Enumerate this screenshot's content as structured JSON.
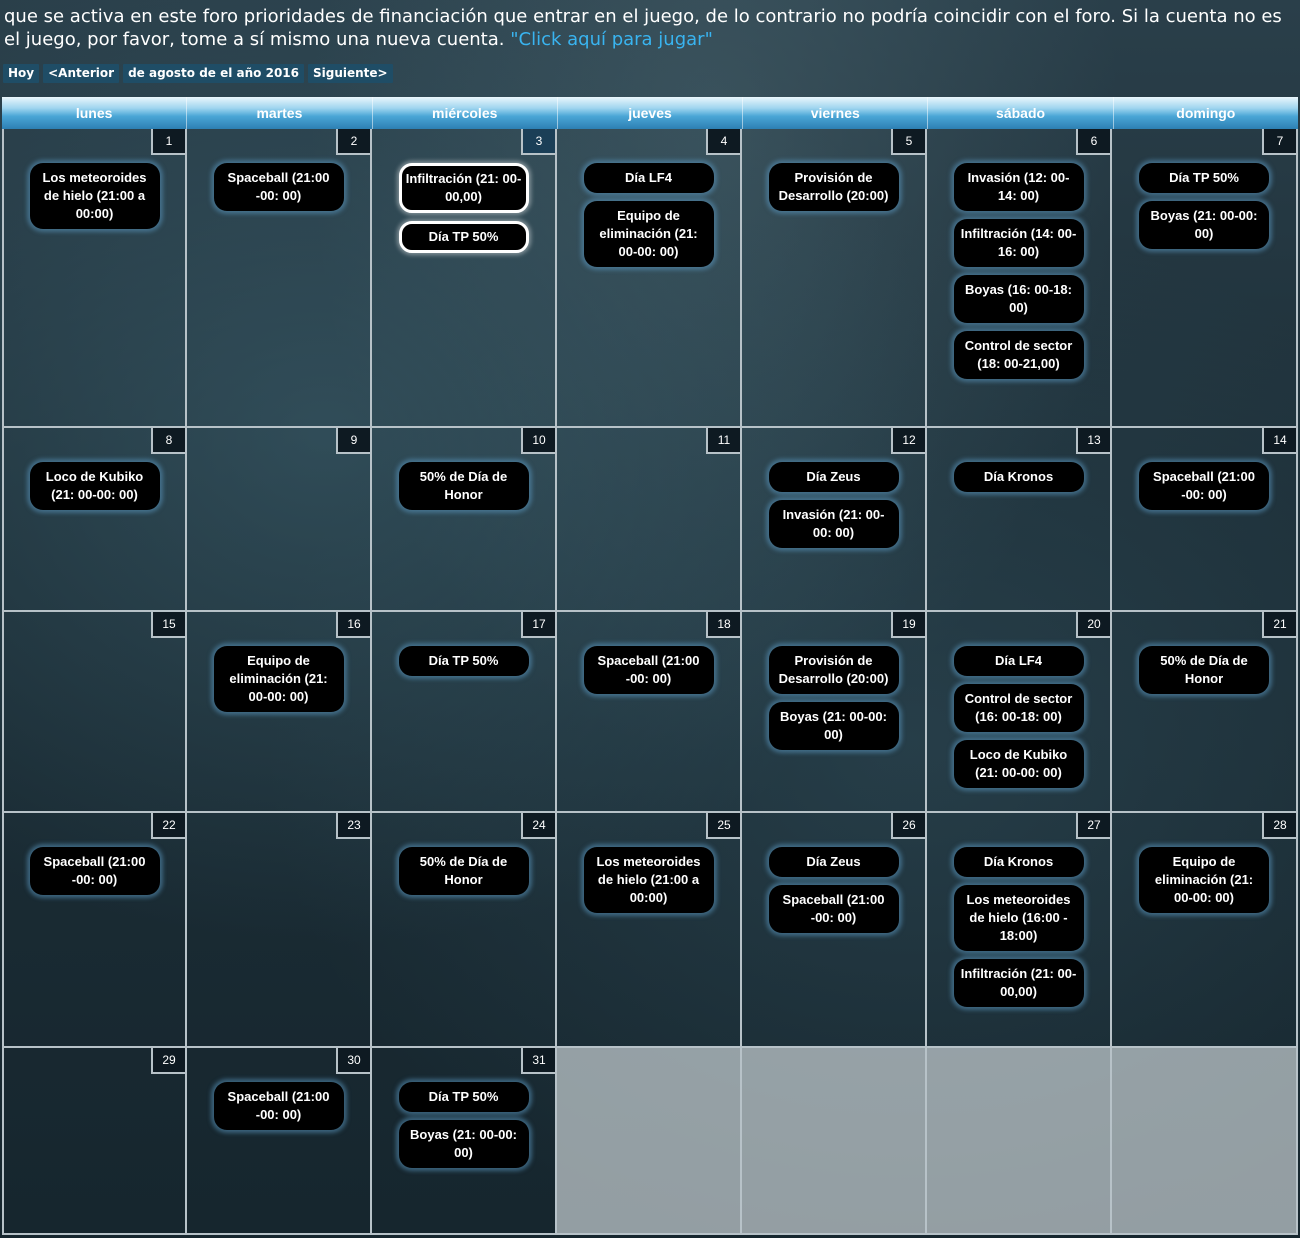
{
  "intro": {
    "text": "que se activa en este foro prioridades de financiación que entrar en el juego, de lo contrario no podría coincidir con el foro. Si la cuenta no es el juego, por favor, tome a sí mismo una nueva cuenta. ",
    "link": "\"Click aquí para jugar\""
  },
  "nav": {
    "today": "Hoy",
    "prev": "<Anterior",
    "month": "de agosto de el año 2016",
    "next": "Siguiente>"
  },
  "weekdays": [
    "lunes",
    "martes",
    "miércoles",
    "jueves",
    "viernes",
    "sábado",
    "domingo"
  ],
  "today_day": 3,
  "weeks": [
    [
      {
        "day": "1",
        "events": [
          "Los meteoroides de hielo (21:00 a 00:00)"
        ]
      },
      {
        "day": "2",
        "events": [
          "Spaceball (21:00 -00: 00)"
        ]
      },
      {
        "day": "3",
        "events": [
          "Infiltración (21: 00-00,00)",
          "Día TP 50%"
        ]
      },
      {
        "day": "4",
        "events": [
          "Día LF4",
          "Equipo de eliminación (21: 00-00: 00)"
        ]
      },
      {
        "day": "5",
        "events": [
          "Provisión de Desarrollo (20:00)"
        ]
      },
      {
        "day": "6",
        "events": [
          "Invasión (12: 00-14: 00)",
          "Infiltración (14: 00-16: 00)",
          "Boyas (16: 00-18: 00)",
          "Control de sector (18: 00-21,00)"
        ]
      },
      {
        "day": "7",
        "events": [
          "Día TP 50%",
          "Boyas (21: 00-00: 00)"
        ]
      }
    ],
    [
      {
        "day": "8",
        "events": [
          "Loco de Kubiko (21: 00-00: 00)"
        ]
      },
      {
        "day": "9",
        "events": []
      },
      {
        "day": "10",
        "events": [
          "50% de Día de Honor"
        ]
      },
      {
        "day": "11",
        "events": []
      },
      {
        "day": "12",
        "events": [
          "Día Zeus",
          "Invasión (21: 00-00: 00)"
        ]
      },
      {
        "day": "13",
        "events": [
          "Día Kronos"
        ]
      },
      {
        "day": "14",
        "events": [
          "Spaceball (21:00 -00: 00)"
        ]
      }
    ],
    [
      {
        "day": "15",
        "events": []
      },
      {
        "day": "16",
        "events": [
          "Equipo de eliminación (21: 00-00: 00)"
        ]
      },
      {
        "day": "17",
        "events": [
          "Día TP 50%"
        ]
      },
      {
        "day": "18",
        "events": [
          "Spaceball (21:00 -00: 00)"
        ]
      },
      {
        "day": "19",
        "events": [
          "Provisión de Desarrollo (20:00)",
          "Boyas (21: 00-00: 00)"
        ]
      },
      {
        "day": "20",
        "events": [
          "Día LF4",
          "Control de sector (16: 00-18: 00)",
          "Loco de Kubiko (21: 00-00: 00)"
        ]
      },
      {
        "day": "21",
        "events": [
          "50% de Día de Honor"
        ]
      }
    ],
    [
      {
        "day": "22",
        "events": [
          "Spaceball (21:00 -00: 00)"
        ]
      },
      {
        "day": "23",
        "events": []
      },
      {
        "day": "24",
        "events": [
          "50% de Día de Honor"
        ]
      },
      {
        "day": "25",
        "events": [
          "Los meteoroides de hielo (21:00 a 00:00)"
        ]
      },
      {
        "day": "26",
        "events": [
          "Día Zeus",
          "Spaceball (21:00 -00: 00)"
        ]
      },
      {
        "day": "27",
        "events": [
          "Día Kronos",
          "Los meteoroides de hielo (16:00 - 18:00)",
          "Infiltración (21: 00-00,00)"
        ]
      },
      {
        "day": "28",
        "events": [
          "Equipo de eliminación (21: 00-00: 00)"
        ]
      }
    ],
    [
      {
        "day": "29",
        "events": []
      },
      {
        "day": "30",
        "events": [
          "Spaceball (21:00 -00: 00)"
        ]
      },
      {
        "day": "31",
        "events": [
          "Día TP 50%",
          "Boyas (21: 00-00: 00)"
        ]
      },
      null,
      null,
      null,
      null
    ]
  ]
}
